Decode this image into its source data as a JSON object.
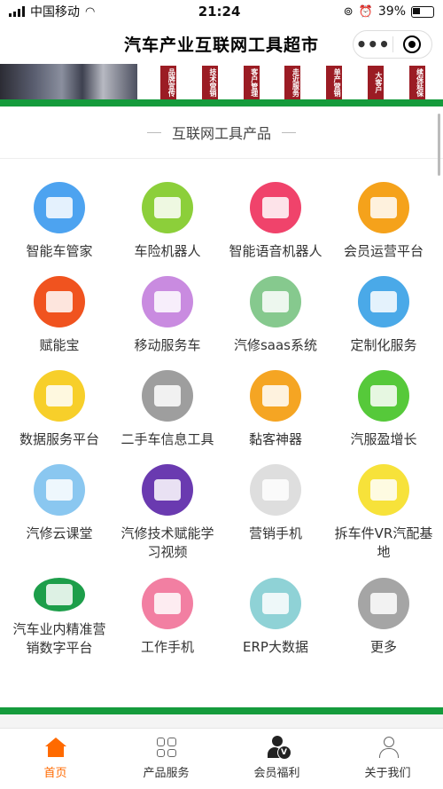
{
  "status_bar": {
    "carrier": "中国移动",
    "time": "21:24",
    "battery": "39%"
  },
  "navbar": {
    "title": "汽车产业互联网工具超市",
    "more": "•••"
  },
  "banner": {
    "tags": [
      "品牌宣传",
      "技术营销",
      "客户管理",
      "走近服务",
      "单产营销",
      "大客户",
      "续保延保"
    ]
  },
  "section": {
    "title": "互联网工具产品",
    "products": [
      {
        "label": "智能车管家",
        "color": "#4da3f0",
        "icon": "headset-car-icon"
      },
      {
        "label": "车险机器人",
        "color": "#8ccf3a",
        "icon": "robot-agent-icon"
      },
      {
        "label": "智能语音机器人",
        "color": "#f0436b",
        "icon": "voice-robot-icon"
      },
      {
        "label": "会员运营平台",
        "color": "#f5a21b",
        "icon": "member-card-icon"
      },
      {
        "label": "赋能宝",
        "color": "#f0531f",
        "icon": "monitor-icon"
      },
      {
        "label": "移动服务车",
        "color": "#c98be0",
        "icon": "service-van-icon"
      },
      {
        "label": "汽修saas系统",
        "color": "#86c98e",
        "icon": "phone-chart-icon"
      },
      {
        "label": "定制化服务",
        "color": "#4aa9e8",
        "icon": "book-icon"
      },
      {
        "label": "数据服务平台",
        "color": "#f7cf2a",
        "icon": "data-search-icon"
      },
      {
        "label": "二手车信息工具",
        "color": "#9e9e9e",
        "icon": "taxi-icon"
      },
      {
        "label": "黏客神器",
        "color": "#f5a523",
        "icon": "vip-card-icon"
      },
      {
        "label": "汽服盈增长",
        "color": "#56c93a",
        "icon": "wallet-icon"
      },
      {
        "label": "汽修云课堂",
        "color": "#8ac7f0",
        "icon": "laptop-books-icon"
      },
      {
        "label": "汽修技术赋能学习视频",
        "color": "#6a3ab0",
        "icon": "video-books-icon"
      },
      {
        "label": "营销手机",
        "color": "#dedede",
        "icon": "marketing-phone-icon"
      },
      {
        "label": "拆车件VR汽配基地",
        "color": "#f7e23a",
        "icon": "vr-parts-icon"
      },
      {
        "label": "汽车业内精准营销数字平台",
        "color": "#1d9e4a",
        "icon": "digital-screen-icon"
      },
      {
        "label": "工作手机",
        "color": "#f27fa2",
        "icon": "work-phone-icon"
      },
      {
        "label": "ERP大数据",
        "color": "#8fd2d6",
        "icon": "erp-search-icon"
      },
      {
        "label": "更多",
        "color": "#a5a5a5",
        "icon": "gears-icon"
      }
    ]
  },
  "tabbar": {
    "items": [
      {
        "label": "首页"
      },
      {
        "label": "产品服务"
      },
      {
        "label": "会员福利"
      },
      {
        "label": "关于我们"
      }
    ]
  }
}
